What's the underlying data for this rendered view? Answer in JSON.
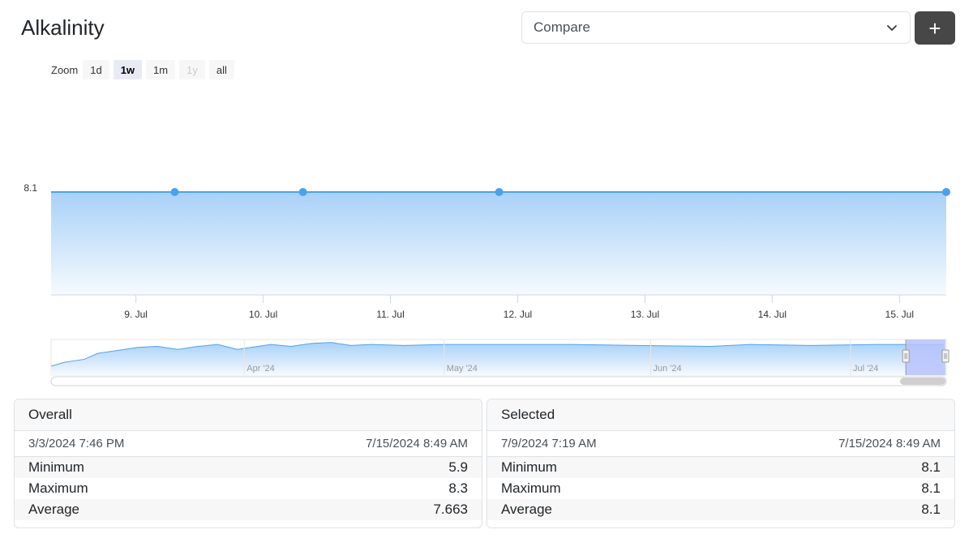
{
  "page_title": "Alkalinity",
  "compare": {
    "value": "Compare"
  },
  "add_button_label": "+",
  "zoom": {
    "label": "Zoom",
    "buttons": [
      {
        "label": "1d",
        "state": "normal"
      },
      {
        "label": "1w",
        "state": "active"
      },
      {
        "label": "1m",
        "state": "normal"
      },
      {
        "label": "1y",
        "state": "disabled"
      },
      {
        "label": "all",
        "state": "normal"
      }
    ]
  },
  "colors": {
    "series_line": "#4ea3ea",
    "series_point": "#4aa2ec",
    "area_top": "#a8d1f8",
    "area_bottom": "#f6fafe",
    "navigator_mask": "#b7c3fb",
    "add_button_bg": "#474747"
  },
  "chart_data": [
    {
      "type": "line",
      "title": "",
      "xlabel": "",
      "ylabel": "",
      "x_ticks": [
        "9. Jul",
        "10. Jul",
        "11. Jul",
        "12. Jul",
        "13. Jul",
        "14. Jul",
        "15. Jul"
      ],
      "y_ticks": [
        "8.1"
      ],
      "grid": false,
      "area_fill": true,
      "points": [
        {
          "x": "2024-07-09 07:19",
          "y": 8.1
        },
        {
          "x": "2024-07-10 07:30",
          "y": 8.1
        },
        {
          "x": "2024-07-11 20:30",
          "y": 8.1
        },
        {
          "x": "2024-07-15 08:49",
          "y": 8.1
        }
      ]
    },
    {
      "type": "area",
      "role": "navigator",
      "x_ticks": [
        "Apr '24",
        "May '24",
        "Jun '24",
        "Jul '24"
      ],
      "selected_range": [
        "2024-07-09 07:19",
        "2024-07-15 08:49"
      ],
      "points": [
        {
          "x": "2024-03-03",
          "y": 5.9
        },
        {
          "x": "2024-03-05",
          "y": 6.3
        },
        {
          "x": "2024-03-08",
          "y": 6.6
        },
        {
          "x": "2024-03-10",
          "y": 7.2
        },
        {
          "x": "2024-03-13",
          "y": 7.5
        },
        {
          "x": "2024-03-16",
          "y": 7.8
        },
        {
          "x": "2024-03-19",
          "y": 7.9
        },
        {
          "x": "2024-03-22",
          "y": 7.6
        },
        {
          "x": "2024-03-25",
          "y": 7.9
        },
        {
          "x": "2024-03-28",
          "y": 8.1
        },
        {
          "x": "2024-03-31",
          "y": 7.6
        },
        {
          "x": "2024-04-02",
          "y": 7.8
        },
        {
          "x": "2024-04-05",
          "y": 8.1
        },
        {
          "x": "2024-04-08",
          "y": 7.9
        },
        {
          "x": "2024-04-11",
          "y": 8.2
        },
        {
          "x": "2024-04-14",
          "y": 8.3
        },
        {
          "x": "2024-04-17",
          "y": 8.0
        },
        {
          "x": "2024-04-20",
          "y": 8.1
        },
        {
          "x": "2024-04-25",
          "y": 8.0
        },
        {
          "x": "2024-05-01",
          "y": 8.1
        },
        {
          "x": "2024-05-10",
          "y": 8.1
        },
        {
          "x": "2024-05-20",
          "y": 8.1
        },
        {
          "x": "2024-05-30",
          "y": 8.0
        },
        {
          "x": "2024-06-10",
          "y": 7.9
        },
        {
          "x": "2024-06-16",
          "y": 8.1
        },
        {
          "x": "2024-06-25",
          "y": 8.0
        },
        {
          "x": "2024-07-05",
          "y": 8.1
        },
        {
          "x": "2024-07-15",
          "y": 8.1
        }
      ]
    }
  ],
  "overall": {
    "title": "Overall",
    "range_start": "3/3/2024 7:46 PM",
    "range_end": "7/15/2024 8:49 AM",
    "stats": [
      {
        "label": "Minimum",
        "value": "5.9"
      },
      {
        "label": "Maximum",
        "value": "8.3"
      },
      {
        "label": "Average",
        "value": "7.663"
      }
    ]
  },
  "selected": {
    "title": "Selected",
    "range_start": "7/9/2024 7:19 AM",
    "range_end": "7/15/2024 8:49 AM",
    "stats": [
      {
        "label": "Minimum",
        "value": "8.1"
      },
      {
        "label": "Maximum",
        "value": "8.1"
      },
      {
        "label": "Average",
        "value": "8.1"
      }
    ]
  }
}
